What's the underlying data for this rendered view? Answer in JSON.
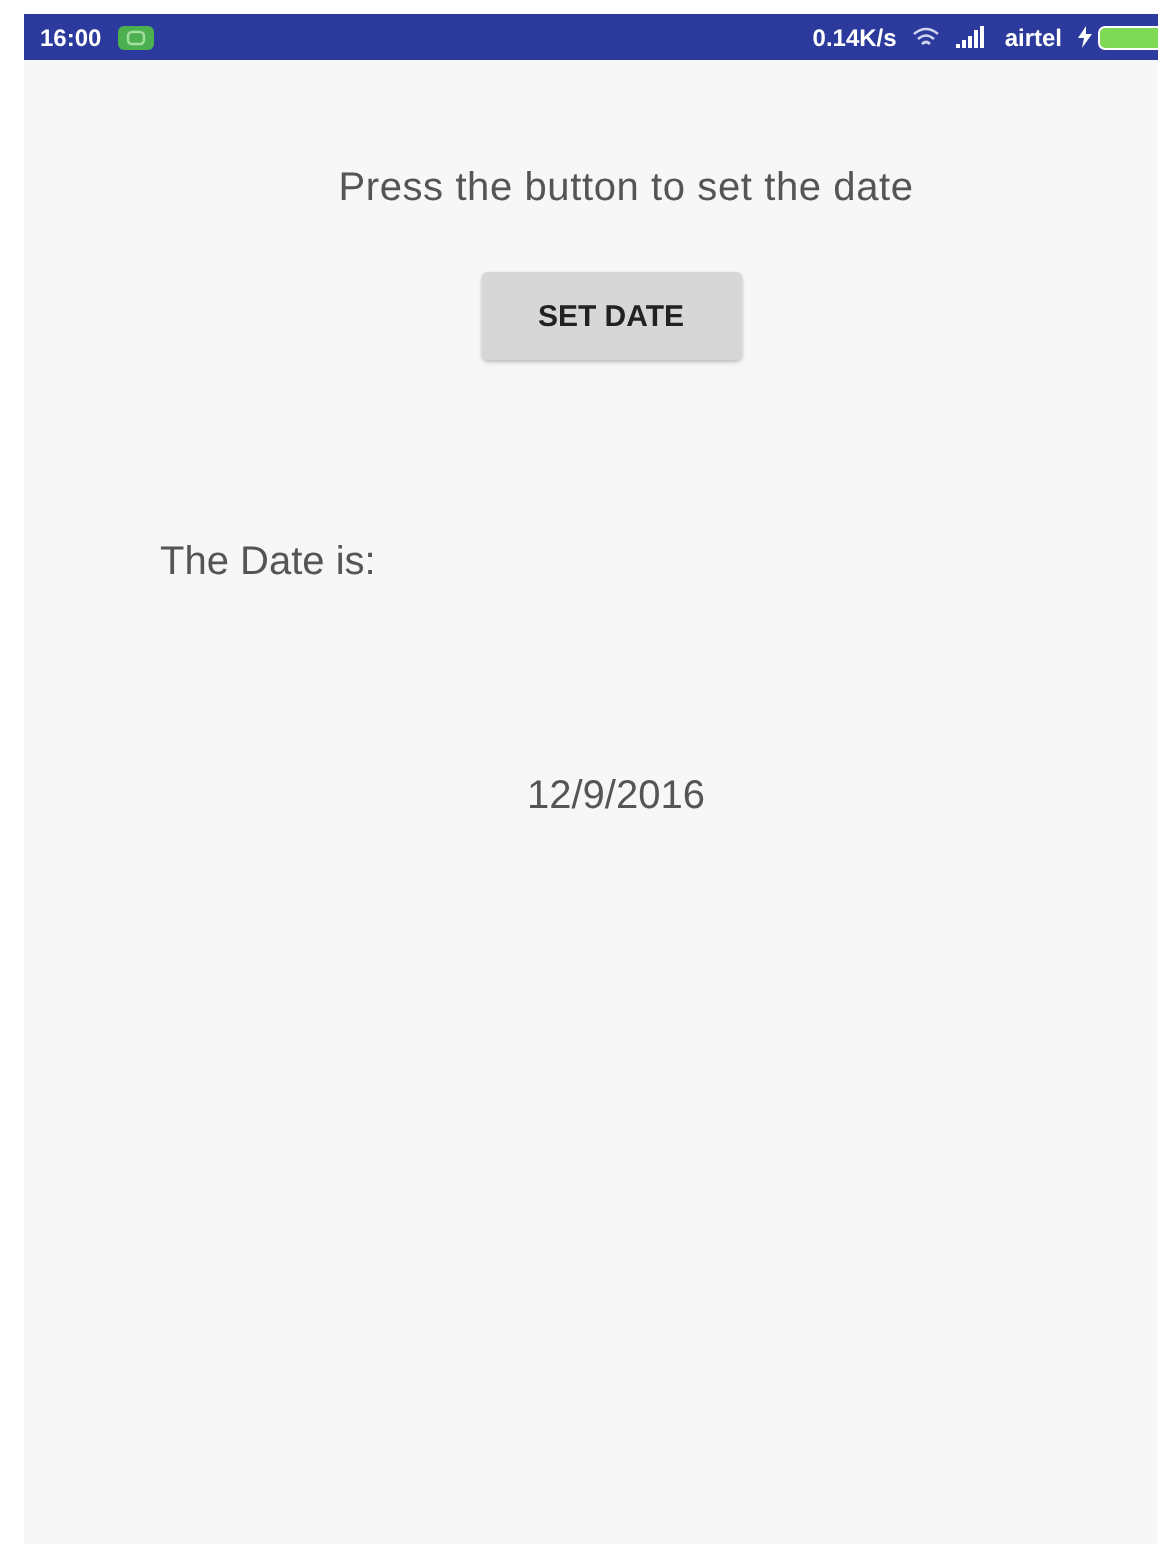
{
  "status_bar": {
    "time": "16:00",
    "speed": "0.14K/s",
    "carrier": "airtel"
  },
  "prompt": "Press the button to set the date",
  "button": "SET DATE",
  "date_label": "The Date is:",
  "date_value": "12/9/2016"
}
